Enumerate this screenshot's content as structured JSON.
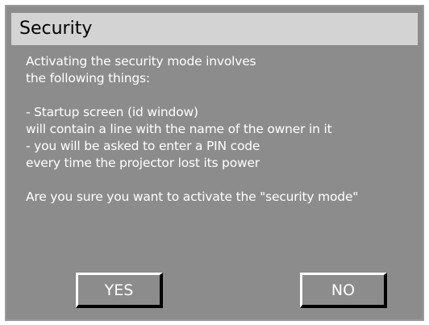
{
  "dialog": {
    "title": "Security",
    "lines": [
      "Activating the security mode involves",
      "the following things:",
      "",
      "- Startup screen (id window)",
      "will contain a line with the name of the owner in it",
      "- you will be asked to enter a PIN code",
      "every time the projector lost its power",
      "",
      "Are you sure you want to activate the \"security mode\""
    ],
    "yes_label": "YES",
    "no_label": "NO"
  },
  "colors": {
    "panel": "#8c8c8c",
    "title_bar": "#d3d3d3",
    "text": "#ffffff"
  }
}
